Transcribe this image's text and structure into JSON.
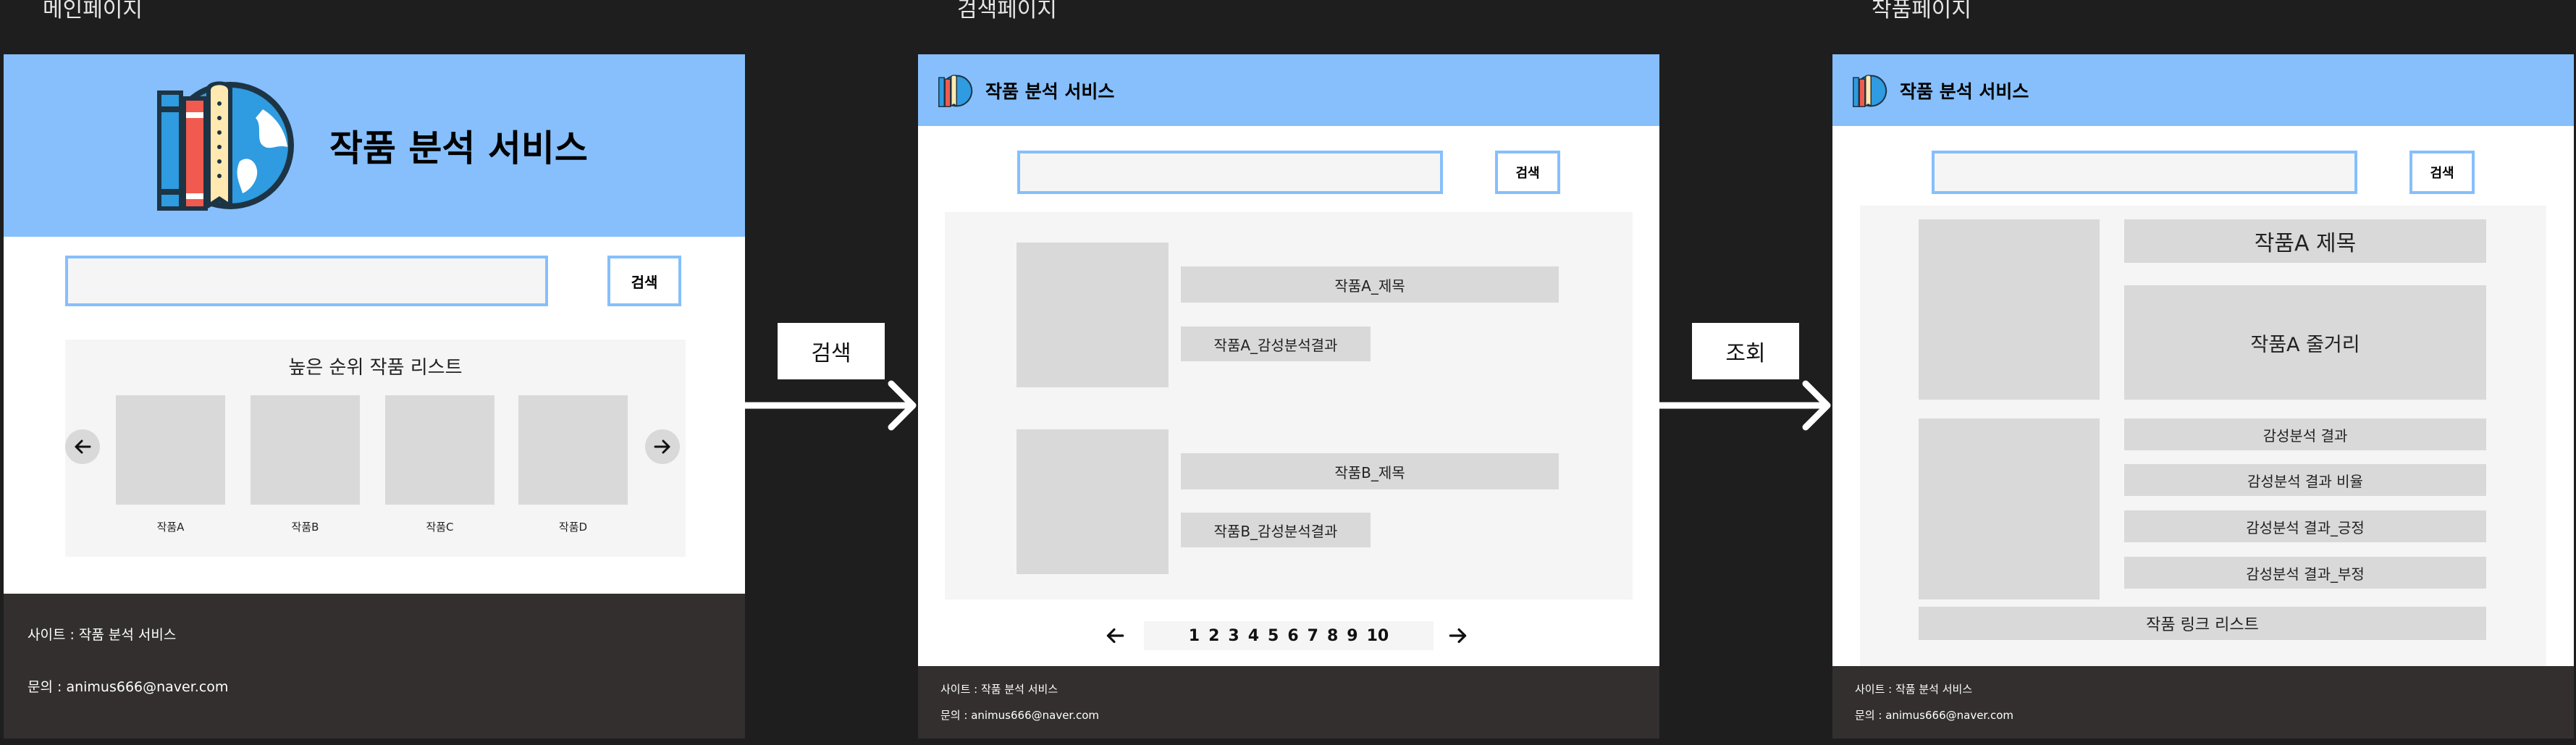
{
  "frames": {
    "main": {
      "label": "메인페이지",
      "title": "작품 분석 서비스",
      "search_button": "검색",
      "list_title": "높은 순위 작품 리스트",
      "items": [
        "작품A",
        "작품B",
        "작품C",
        "작품D"
      ],
      "footer_site": "사이트 : 작품 분석 서비스",
      "footer_contact": "문의 : animus666@naver.com"
    },
    "search": {
      "label": "검색페이지",
      "title": "작품 분석 서비스",
      "search_button": "검색",
      "results": [
        {
          "title": "작품A_제목",
          "analysis": "작품A_감성분석결과"
        },
        {
          "title": "작품B_제목",
          "analysis": "작품B_감성분석결과"
        }
      ],
      "pages": [
        "1",
        "2",
        "3",
        "4",
        "5",
        "6",
        "7",
        "8",
        "9",
        "10"
      ],
      "footer_site": "사이트 : 작품 분석 서비스",
      "footer_contact": "문의 : animus666@naver.com"
    },
    "work": {
      "label": "작품페이지",
      "title": "작품 분석 서비스",
      "search_button": "검색",
      "work_title": "작품A 제목",
      "synopsis": "작품A 줄거리",
      "results": [
        "감성분석 결과",
        "감성분석 결과 비율",
        "감성분석 결과_긍정",
        "감성분석 결과_부정"
      ],
      "link_list": "작품 링크 리스트",
      "footer_site": "사이트 : 작품 분석 서비스",
      "footer_contact": "문의 : animus666@naver.com"
    }
  },
  "flow": {
    "search": "검색",
    "view": "조회"
  },
  "icons": [
    "books-globe-logo-icon",
    "arrow-left-icon",
    "arrow-right-icon",
    "flow-arrow-icon"
  ],
  "colors": {
    "background": "#1e1e1e",
    "header": "#86bffc",
    "footer": "#332f2f",
    "placeholder": "#d9d9d9",
    "panel": "#f5f5f5"
  }
}
